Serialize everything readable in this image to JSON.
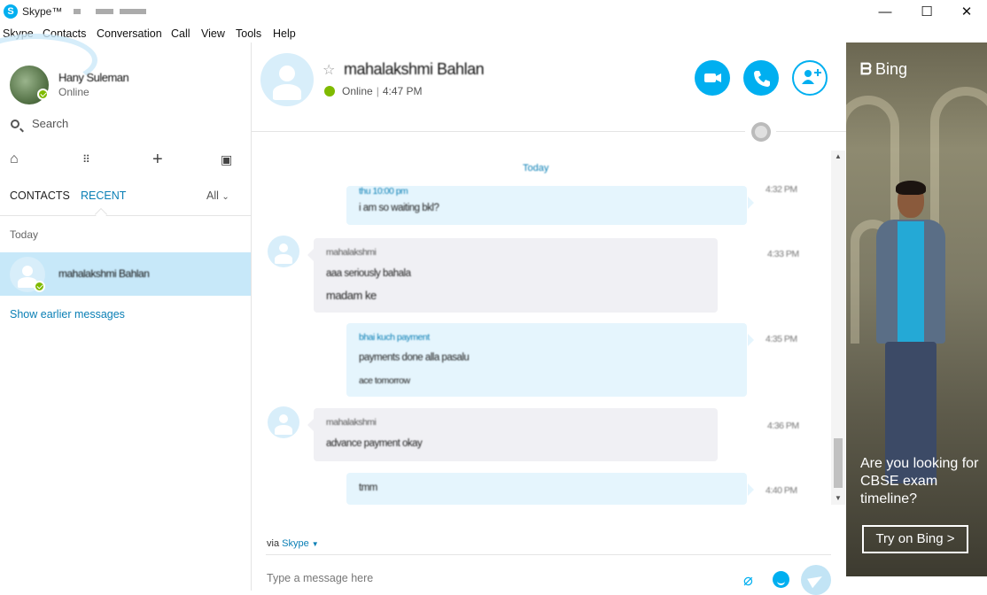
{
  "window": {
    "app_title": "Skype™",
    "controls": {
      "minimize": "—",
      "maximize": "☐",
      "close": "✕"
    }
  },
  "menu": [
    "Skype",
    "Contacts",
    "Conversation",
    "Call",
    "View",
    "Tools",
    "Help"
  ],
  "profile": {
    "name": "Hany Suleman",
    "status": "Online"
  },
  "search": {
    "placeholder": "Search"
  },
  "tabs": {
    "contacts": "CONTACTS",
    "recent": "RECENT",
    "filter": "All"
  },
  "recent": {
    "section_label": "Today",
    "items": [
      {
        "name": "mahalakshmi Bahlan"
      }
    ],
    "show_earlier": "Show earlier messages"
  },
  "conversation": {
    "contact_name": "mahalakshmi Bahlan",
    "status": "Online",
    "time": "4:47 PM",
    "day_label": "Today",
    "messages": [
      {
        "direction": "out",
        "lines": [
          "thu 10:00 pm",
          "i am so waiting bkl?"
        ],
        "time": "4:32 PM"
      },
      {
        "direction": "in",
        "lines": [
          "mahalakshmi",
          "aaa seriously bahala",
          "madam ke"
        ],
        "time": "4:33 PM"
      },
      {
        "direction": "out",
        "lines": [
          "bhai kuch payment",
          "payments done alla pasalu",
          "ace tomorrow"
        ],
        "time": "4:35 PM"
      },
      {
        "direction": "in",
        "lines": [
          "mahalakshmi",
          "advance payment okay"
        ],
        "time": "4:36 PM"
      },
      {
        "direction": "out",
        "lines": [
          "tmm"
        ],
        "time": "4:40 PM"
      }
    ],
    "via_label": "via",
    "via_link": "Skype",
    "compose_placeholder": "Type a message here"
  },
  "ad": {
    "brand": "Bing",
    "headline": "Are you looking for CBSE exam timeline?",
    "cta": "Try on Bing >"
  },
  "colors": {
    "accent": "#00aff0",
    "online": "#7fba00",
    "selected_row": "#c7e8f9"
  }
}
